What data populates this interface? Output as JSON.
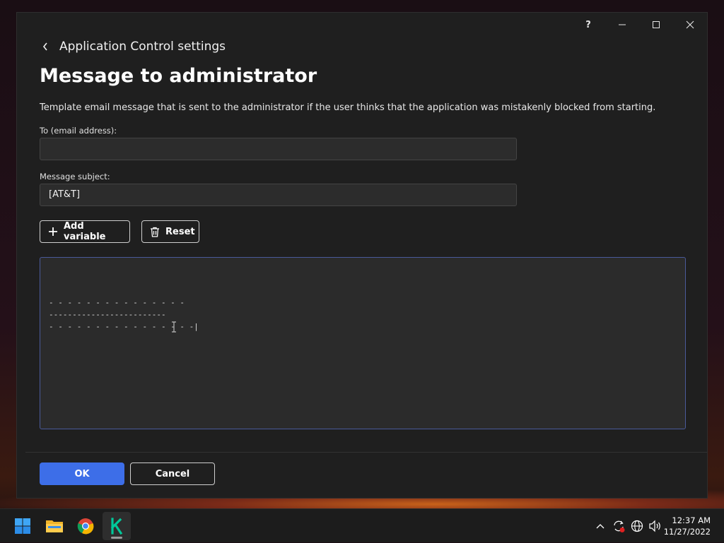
{
  "window": {
    "help_label": "?"
  },
  "breadcrumb": {
    "label": "Application Control settings"
  },
  "page": {
    "title": "Message to administrator",
    "description": "Template email message that is sent to the administrator if the user thinks that the application was mistakenly blocked from starting."
  },
  "fields": {
    "to_label": "To (email address):",
    "to_value": "",
    "subject_label": "Message subject:",
    "subject_value": "[AT&T]"
  },
  "actions": {
    "add_variable_label": "Add variable",
    "reset_label": "Reset"
  },
  "message_body": {
    "lines": [
      "- - - - - - - - - - - - - - -",
      "-------------------------",
      "- - - - - - - - - - - - - - - -|"
    ]
  },
  "footer": {
    "ok_label": "OK",
    "cancel_label": "Cancel"
  },
  "taskbar": {
    "apps": [
      "start-icon",
      "file-explorer-icon",
      "chrome-icon",
      "kaspersky-icon"
    ],
    "time": "12:37 AM",
    "date": "11/27/2022"
  },
  "colors": {
    "accent": "#3d6ee8",
    "window_bg": "#1f1f1f",
    "kaspersky_green": "#00c89a"
  }
}
